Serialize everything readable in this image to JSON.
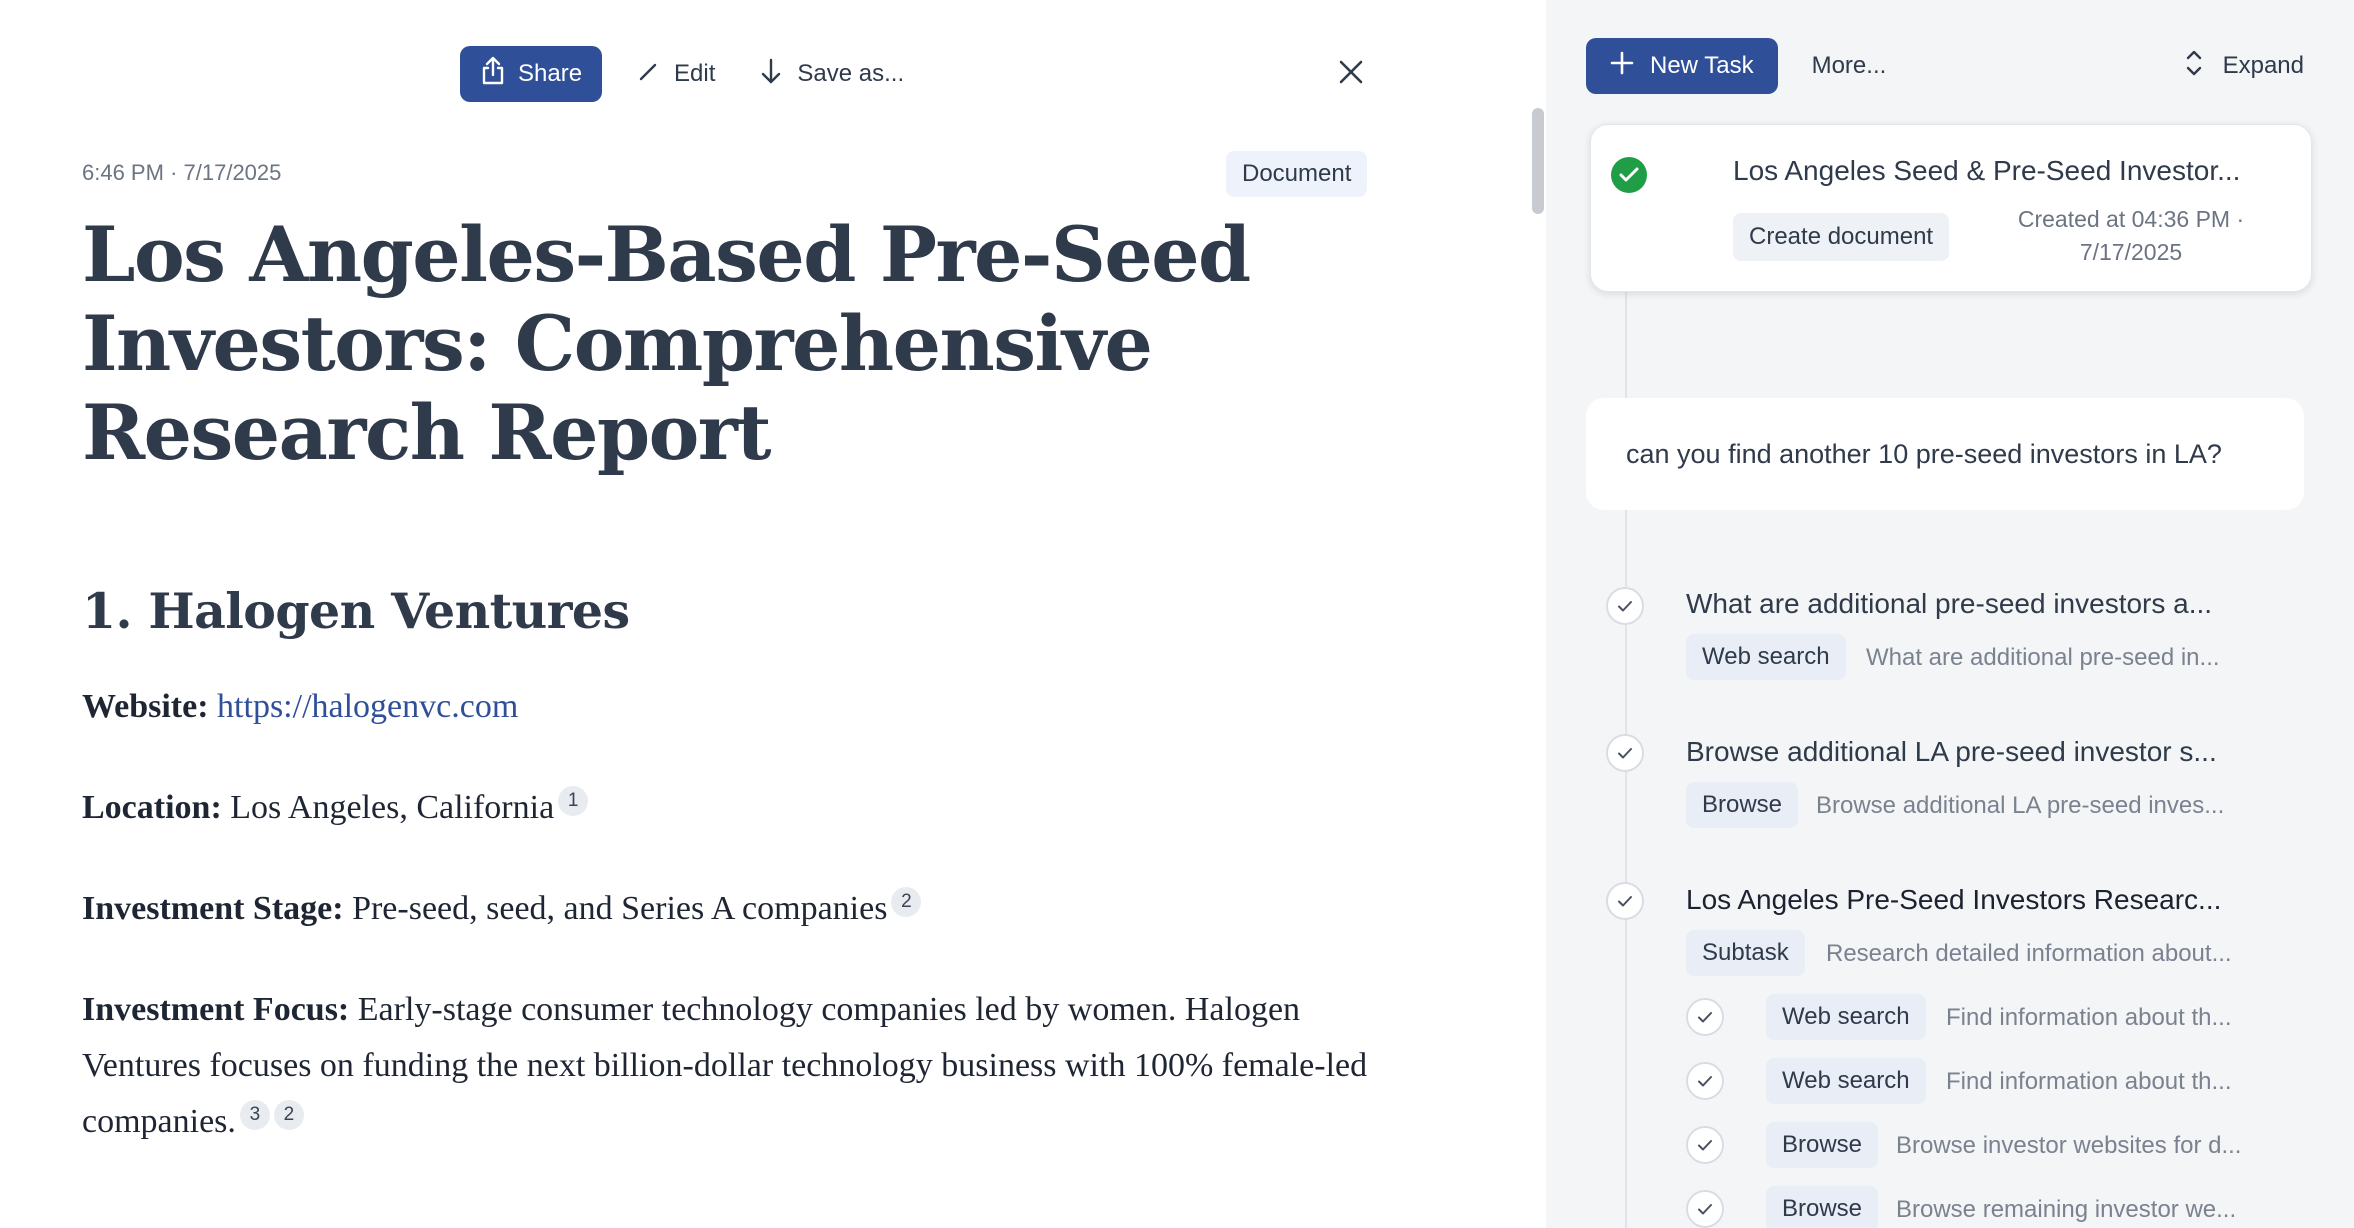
{
  "toolbar": {
    "share_label": "Share",
    "edit_label": "Edit",
    "save_label": "Save as..."
  },
  "document": {
    "time": "6:46 PM",
    "date": "7/17/2025",
    "type_badge": "Document",
    "title": "Los Angeles-Based Pre-Seed Investors: Comprehensive Research Report",
    "section_heading": "1. Halogen Ventures",
    "website_label": "Website:",
    "website_url": "https://halogenvc.com",
    "location_label": "Location:",
    "location_value": "Los Angeles, California",
    "location_cites": [
      "1"
    ],
    "stage_label": "Investment Stage:",
    "stage_value": "Pre-seed, seed, and Series A companies",
    "stage_cites": [
      "2"
    ],
    "focus_label": "Investment Focus:",
    "focus_value": "Early-stage consumer technology companies led by women. Halogen Ventures focuses on funding the next billion-dollar technology business with 100% female-led companies.",
    "focus_cites": [
      "3",
      "2"
    ]
  },
  "task_panel": {
    "new_task_label": "New Task",
    "more_label": "More...",
    "expand_label": "Expand",
    "card": {
      "title": "Los Angeles Seed & Pre-Seed Investor...",
      "chip": "Create document",
      "created_line1": "Created at 04:36 PM ·",
      "created_line2": "7/17/2025"
    },
    "user_message": "can you find another 10 pre-seed investors in LA?",
    "steps": [
      {
        "title": "What are additional pre-seed investors a...",
        "chip": "Web search",
        "desc": "What are additional pre-seed in..."
      },
      {
        "title": "Browse additional LA pre-seed investor s...",
        "chip": "Browse",
        "desc": "Browse additional LA pre-seed inves..."
      },
      {
        "title": "Los Angeles Pre-Seed Investors Researc...",
        "chip": "Subtask",
        "desc": "Research detailed information about..."
      }
    ],
    "substeps": [
      {
        "chip": "Web search",
        "desc": "Find information about th..."
      },
      {
        "chip": "Web search",
        "desc": "Find information about th..."
      },
      {
        "chip": "Browse",
        "desc": "Browse investor websites for d..."
      },
      {
        "chip": "Browse",
        "desc": "Browse remaining investor we..."
      }
    ]
  },
  "colors": {
    "primary": "#2f4f98",
    "success": "#1f9d47",
    "panel_bg": "#f4f5f7"
  },
  "icons": [
    "share-icon",
    "pencil-icon",
    "arrow-down-icon",
    "close-icon",
    "plus-icon",
    "expand-icon",
    "check-icon"
  ]
}
